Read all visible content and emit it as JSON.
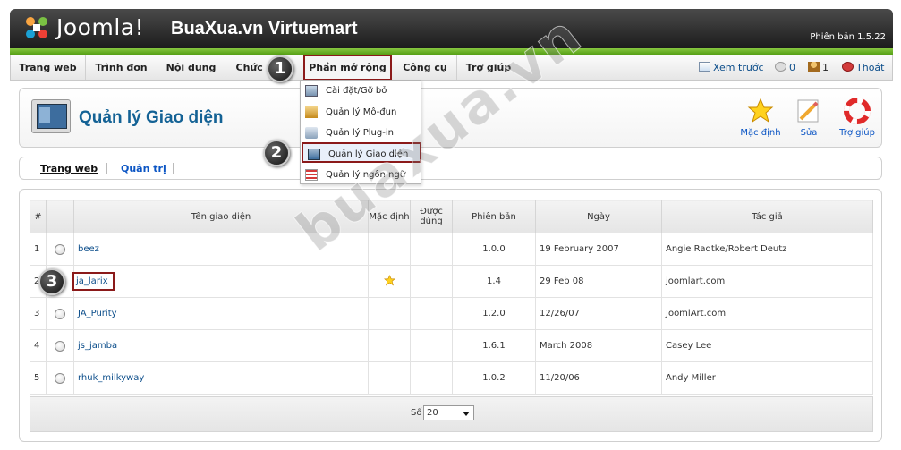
{
  "header": {
    "logo_text": "Joomla!",
    "site_name": "BuaXua.vn Virtuemart",
    "version": "Phiên bản 1.5.22"
  },
  "menubar": {
    "items": [
      {
        "label": "Trang web"
      },
      {
        "label": "Trình đơn"
      },
      {
        "label": "Nội dung"
      },
      {
        "label": "Chức n"
      },
      {
        "label": "Phần mở rộng",
        "active": true
      },
      {
        "label": "Công cụ"
      },
      {
        "label": "Trợ giúp"
      }
    ],
    "preview_label": "Xem trước",
    "messages_count": "0",
    "users_count": "1",
    "logout_label": "Thoát"
  },
  "dropdown": {
    "items": [
      {
        "label": "Cài đặt/Gỡ bỏ"
      },
      {
        "label": "Quản lý Mô-đun"
      },
      {
        "label": "Quản lý Plug-in"
      },
      {
        "label": "Quản lý Giao diện",
        "selected": true
      },
      {
        "label": "Quản lý ngôn ngữ"
      }
    ]
  },
  "badges": [
    "1",
    "2",
    "3"
  ],
  "page": {
    "title": "Quản lý Giao diện",
    "toolbar": {
      "default_label": "Mặc định",
      "edit_label": "Sửa",
      "help_label": "Trợ giúp"
    }
  },
  "subtabs": {
    "site": "Trang web",
    "admin": "Quản trị"
  },
  "table": {
    "headers": {
      "num": "#",
      "name": "Tên giao diện",
      "default": "Mặc định",
      "assigned": "Được dùng",
      "version": "Phiên bản",
      "date": "Ngày",
      "author": "Tác giả"
    },
    "rows": [
      {
        "num": "1",
        "name": "beez",
        "default": false,
        "version": "1.0.0",
        "date": "19 February 2007",
        "author": "Angie Radtke/Robert Deutz"
      },
      {
        "num": "2",
        "name": "ja_larix",
        "default": true,
        "version": "1.4",
        "date": "29 Feb 08",
        "author": "joomlart.com"
      },
      {
        "num": "3",
        "name": "JA_Purity",
        "default": false,
        "version": "1.2.0",
        "date": "12/26/07",
        "author": "JoomlArt.com"
      },
      {
        "num": "4",
        "name": "js_jamba",
        "default": false,
        "version": "1.6.1",
        "date": "March 2008",
        "author": "Casey Lee"
      },
      {
        "num": "5",
        "name": "rhuk_milkyway",
        "default": false,
        "version": "1.0.2",
        "date": "11/20/06",
        "author": "Andy Miller"
      }
    ],
    "footer": {
      "display_label": "Số",
      "display_value": "20"
    }
  },
  "watermark": "buaxua.vn",
  "colors": {
    "header_dark": "#1c1c1c",
    "green_strip": "#6bb32a",
    "highlight_border": "#8b1a1a",
    "title_blue": "#146295",
    "link_blue": "#0b4d8a"
  }
}
